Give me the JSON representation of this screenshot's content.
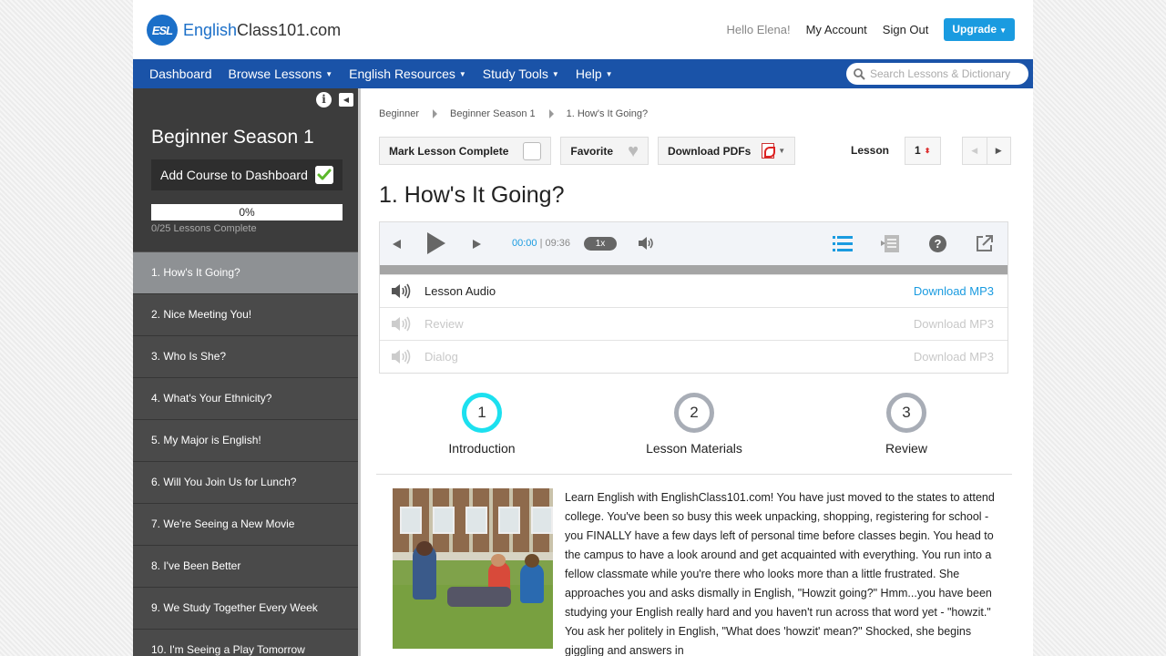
{
  "header": {
    "logo_badge": "ESL",
    "logo_brand_colored": "English",
    "logo_brand_rest": "Class101.com",
    "greeting": "Hello Elena!",
    "my_account": "My Account",
    "sign_out": "Sign Out",
    "upgrade": "Upgrade"
  },
  "nav": {
    "items": [
      "Dashboard",
      "Browse Lessons",
      "English Resources",
      "Study Tools",
      "Help"
    ],
    "search_placeholder": "Search Lessons & Dictionary"
  },
  "sidebar": {
    "info_icon": "i",
    "course_title": "Beginner Season 1",
    "add_course": "Add Course to Dashboard",
    "progress_percent": "0%",
    "progress_value": 0,
    "progress_sub": "0/25 Lessons Complete",
    "lessons": [
      "1. How's It Going?",
      "2. Nice Meeting You!",
      "3. Who Is She?",
      "4. What's Your Ethnicity?",
      "5. My Major is English!",
      "6. Will You Join Us for Lunch?",
      "7. We're Seeing a New Movie",
      "8. I've Been Better",
      "9. We Study Together Every Week",
      "10. I'm Seeing a Play Tomorrow"
    ],
    "active_index": 0
  },
  "breadcrumb": [
    "Beginner",
    "Beginner Season 1",
    "1. How's It Going?"
  ],
  "toolbar": {
    "mark_complete": "Mark Lesson Complete",
    "favorite": "Favorite",
    "download_pdfs": "Download PDFs",
    "lesson_label": "Lesson",
    "lesson_number": "1"
  },
  "lesson_title": "1. How's It Going?",
  "player": {
    "current_time": "00:00",
    "total_time": "09:36",
    "speed": "1x",
    "tracks": [
      {
        "name": "Lesson Audio",
        "download": "Download MP3",
        "enabled": true
      },
      {
        "name": "Review",
        "download": "Download MP3",
        "enabled": false
      },
      {
        "name": "Dialog",
        "download": "Download MP3",
        "enabled": false
      }
    ]
  },
  "steps": [
    {
      "number": "1",
      "label": "Introduction",
      "active": true
    },
    {
      "number": "2",
      "label": "Lesson Materials",
      "active": false
    },
    {
      "number": "3",
      "label": "Review",
      "active": false
    }
  ],
  "description": "Learn English with EnglishClass101.com! You have just moved to the states to attend college. You've been so busy this week unpacking, shopping, registering for school - you FINALLY have a few days left of personal time before classes begin. You head to the campus to have a look around and get acquainted with everything. You run into a fellow classmate while you're there who looks more than a little frustrated. She approaches you and asks dismally in English, \"Howzit going?\" Hmm...you have been studying your English really hard and you haven't run across that word yet - \"howzit.\" You ask her politely in English, \"What does 'howzit' mean?\" Shocked, she begins giggling and answers in"
}
